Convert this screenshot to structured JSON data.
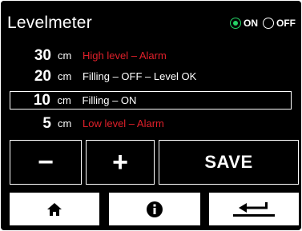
{
  "header": {
    "title": "Levelmeter",
    "toggle": {
      "on_label": "ON",
      "off_label": "OFF",
      "selected": "ON"
    }
  },
  "levels": [
    {
      "value": "30",
      "unit": "cm",
      "description": "High level – Alarm",
      "color": "#e0202a",
      "selected": false
    },
    {
      "value": "20",
      "unit": "cm",
      "description": "Filling – OFF – Level OK",
      "color": "#ffffff",
      "selected": false
    },
    {
      "value": "10",
      "unit": "cm",
      "description": "Filling – ON",
      "color": "#ffffff",
      "selected": true
    },
    {
      "value": "5",
      "unit": "cm",
      "description": "Low level – Alarm",
      "color": "#e0202a",
      "selected": false
    }
  ],
  "controls": {
    "minus_label": "−",
    "plus_label": "+",
    "save_label": "SAVE"
  },
  "nav": {
    "home_icon": "home-icon",
    "info_icon": "info-icon",
    "back_icon": "return-arrow-icon"
  },
  "colors": {
    "background": "#000000",
    "alarm": "#e0202a",
    "accent_on": "#25d366",
    "text": "#ffffff"
  }
}
